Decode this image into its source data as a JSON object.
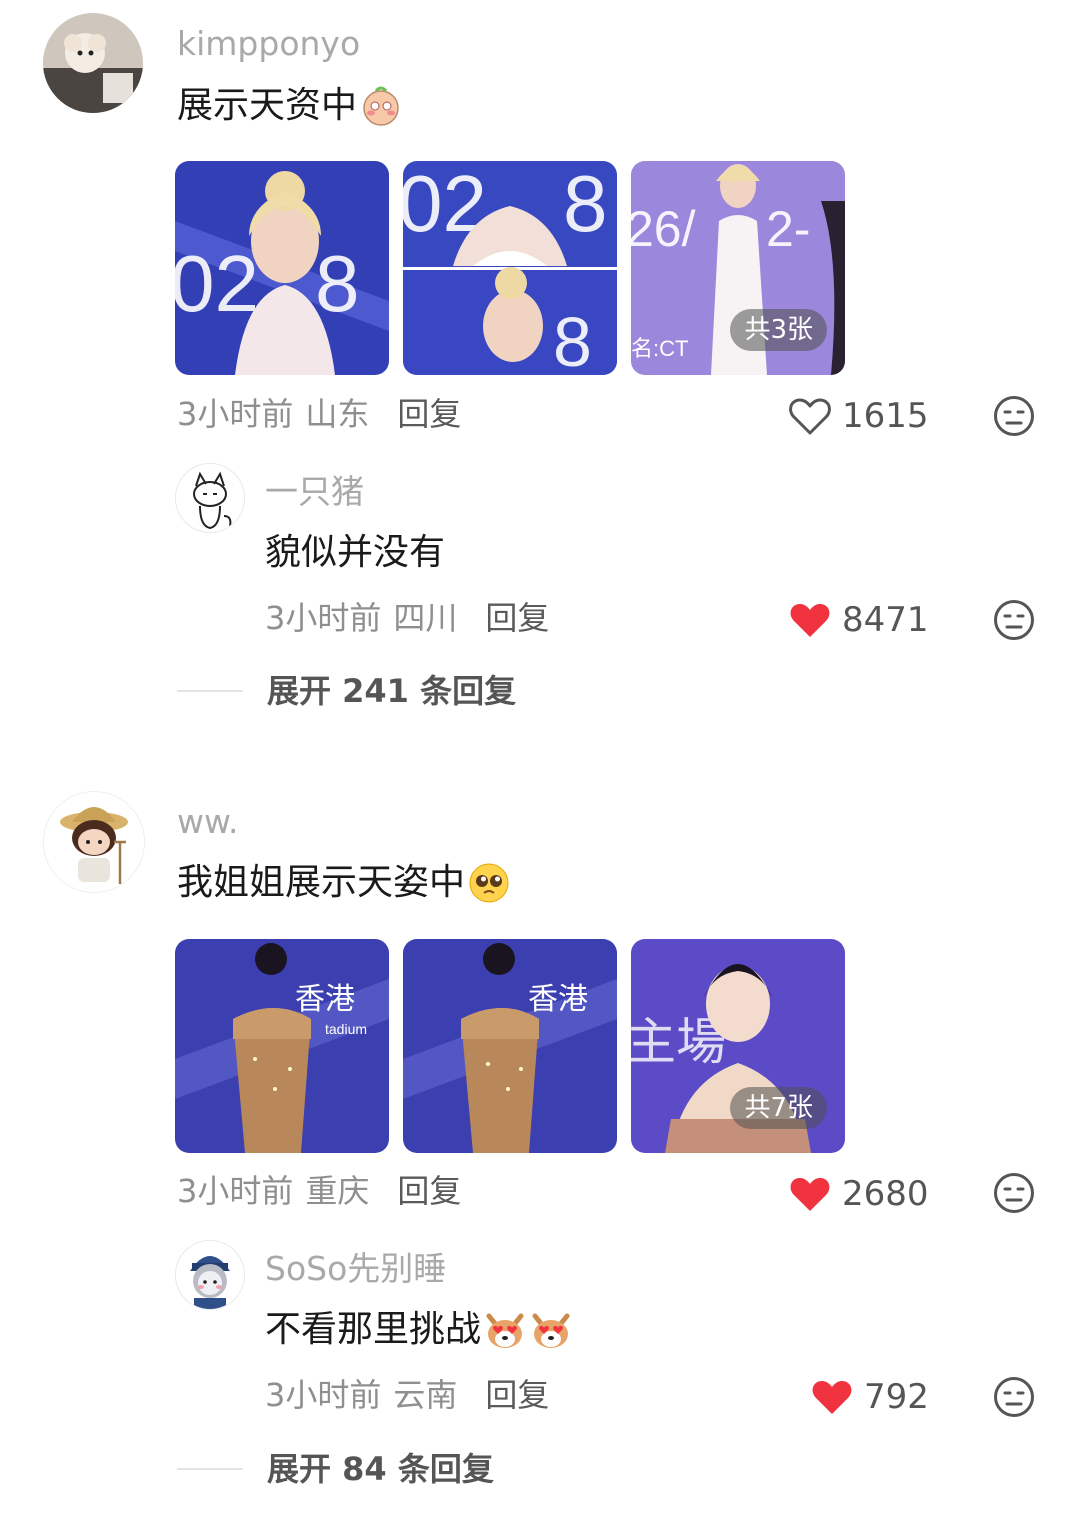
{
  "comments": [
    {
      "username": "kimpponyo",
      "text": "展示天资中",
      "emoji": "blushing-face-emoji",
      "images_more_label": "共3张",
      "time": "3小时前",
      "location": "山东",
      "reply_label": "回复",
      "likes": "1615",
      "liked": false,
      "reply": {
        "username": "一只猪",
        "text": "貌似并没有",
        "time": "3小时前",
        "location": "四川",
        "reply_label": "回复",
        "likes": "8471",
        "liked": true
      },
      "expand_label": "展开 241 条回复"
    },
    {
      "username": "ww.",
      "text": "我姐姐展示天姿中",
      "emoji": "pleading-face-emoji",
      "images_more_label": "共7张",
      "time": "3小时前",
      "location": "重庆",
      "reply_label": "回复",
      "likes": "2680",
      "liked": true,
      "reply": {
        "username": "SoSo先别睡",
        "text": "不看那里挑战",
        "emoji": "heart-eyes-dog-emoji",
        "time": "3小时前",
        "location": "云南",
        "reply_label": "回复",
        "likes": "792",
        "liked": true
      },
      "expand_label": "展开 84 条回复"
    }
  ],
  "colors": {
    "liked_heart": "#f0333f",
    "muted_text": "#8f8f8f",
    "username": "#a9a9a9"
  }
}
